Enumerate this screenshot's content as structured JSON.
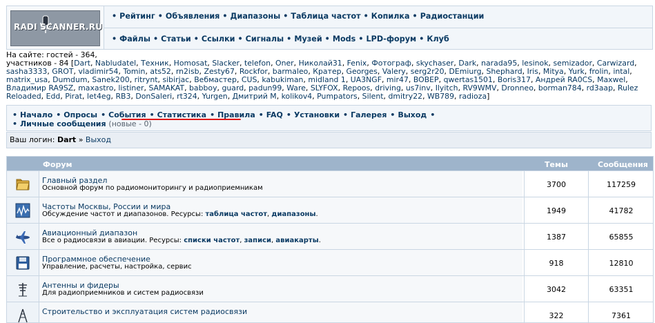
{
  "header": {
    "logo_text": "RADI SCANNER.RU",
    "row1": [
      "Рейтинг",
      "Объявления",
      "Диапазоны",
      "Таблица частот",
      "Копилка",
      "Радиостанции"
    ],
    "row2": [
      "Файлы",
      "Статьи",
      "Ссылки",
      "Сигналы",
      "Музей",
      "Mods",
      "LPD-форум",
      "Клуб"
    ],
    "bullet": "•"
  },
  "online": {
    "guests_line": "На сайте: гостей - 364,",
    "members_prefix": "участников - 84 [",
    "members_suffix": "]",
    "names": [
      "Dart",
      "Nabludatel",
      "Техник",
      "Homosat",
      "Slacker",
      "telefon",
      "Oner",
      "Николай31",
      "Fenix",
      "Фотограф",
      "skychaser",
      "Dark",
      "narada95",
      "lesinok",
      "semizador",
      "Carwizard",
      "sasha3333",
      "GROT",
      "vladimir54",
      "Tomin",
      "ats52",
      "rn2isb",
      "Zesty67",
      "Rockfor",
      "barmaleo",
      "Кратер",
      "Georges",
      "Valery",
      "serg2r20",
      "DEmiurg",
      "Shephard",
      "Iris",
      "Mitya",
      "Yurk",
      "frolin",
      "intal",
      "matrix_usa",
      "Dumdum",
      "Sanek200",
      "ritrynt",
      "sibirjac",
      "Вебмастер",
      "CUS",
      "kabukiman",
      "midland 1",
      "UA3NGF",
      "mir47",
      "BOBEP",
      "qwertas1501",
      "Boris317",
      "Андрей RA0CS",
      "Maxwel",
      "Владимир RA9SZ",
      "maxastro",
      "listiner",
      "SAMAKAT",
      "babboy",
      "guard",
      "padun99",
      "Ware",
      "SLYFOX",
      "Repoos",
      "driving",
      "us7inv",
      "Ilyitch",
      "RV9WMV",
      "Dronneo",
      "borman784",
      "rd3aap",
      "Rulez Reloaded",
      "Edd",
      "Pirat",
      "let4eg",
      "RB3",
      "DonSaleri",
      "rt324",
      "Yurgen",
      "Дмитрий М",
      "kolikov4",
      "Pumpators",
      "Silent",
      "dmitry22",
      "WB789",
      "radioza"
    ]
  },
  "nav": {
    "items": [
      "Начало",
      "Опросы",
      "События",
      "Статистика",
      "Правила",
      "FAQ",
      "Установки",
      "Галерея",
      "Выход"
    ],
    "pm_label": "Личные сообщения",
    "pm_note": "(новые - 0)"
  },
  "login": {
    "label": "Ваш логин:",
    "user": "Dart",
    "arrow": "»",
    "exit": "Выход"
  },
  "table": {
    "col_forum": "Форум",
    "col_topics": "Темы",
    "col_posts": "Сообщения",
    "rows": [
      {
        "name": "Главный раздел",
        "desc": "Основной форум по радиомониторингу и радиоприемникам",
        "resources_label": "",
        "resources": [],
        "topics": "3700",
        "posts": "117259",
        "icon": "folder-icon"
      },
      {
        "name": "Частоты Москвы, России и мира",
        "desc": "Обсуждение частот и диапазонов. Ресурсы:",
        "resources_label": "",
        "resources": [
          "таблица частот",
          "диапазоны"
        ],
        "topics": "1949",
        "posts": "41782",
        "icon": "frequency-icon"
      },
      {
        "name": "Авиационный диапазон",
        "desc": "Все о радиосвязи в авиации. Ресурсы:",
        "resources_label": "",
        "resources": [
          "списки частот",
          "записи",
          "авиакарты"
        ],
        "topics": "1387",
        "posts": "65855",
        "icon": "airplane-icon"
      },
      {
        "name": "Программное обеспечение",
        "desc": "Управление, расчеты, настройка, сервис",
        "resources_label": "",
        "resources": [],
        "topics": "918",
        "posts": "12810",
        "icon": "floppy-disk-icon"
      },
      {
        "name": "Антенны и фидеры",
        "desc": "Для радиоприемников и систем радиосвязи",
        "resources_label": "",
        "resources": [],
        "topics": "3042",
        "posts": "63351",
        "icon": "antenna-icon"
      },
      {
        "name": "Строительство и эксплуатация систем радиосвязи",
        "desc": "",
        "resources_label": "",
        "resources": [],
        "topics": "322",
        "posts": "7361",
        "icon": "tower-icon"
      }
    ]
  },
  "colors": {
    "link": "#0a3a63",
    "table_header": "#9eb4cb",
    "border": "#c9d6e3",
    "highlight_underline": "#e01818"
  }
}
